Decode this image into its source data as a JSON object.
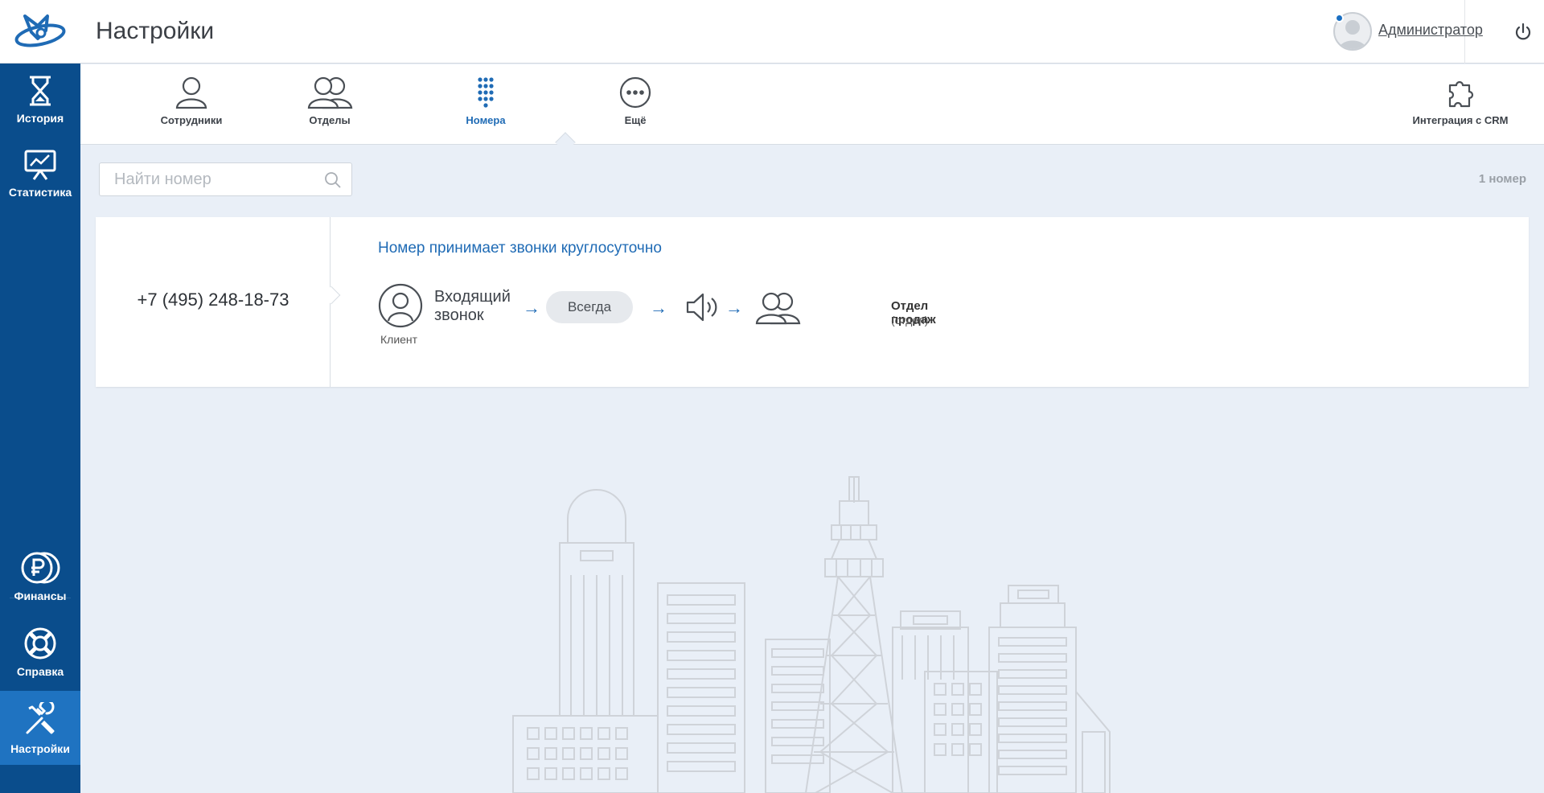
{
  "header": {
    "title": "Настройки",
    "user_name": "Администратор"
  },
  "sidebar": {
    "items": [
      {
        "label": "История",
        "icon": "hourglass-icon"
      },
      {
        "label": "Статистика",
        "icon": "presentation-chart-icon"
      },
      {
        "label": "Финансы",
        "icon": "ruble-coins-icon"
      },
      {
        "label": "Справка",
        "icon": "lifebuoy-icon"
      },
      {
        "label": "Настройки",
        "icon": "tools-icon"
      }
    ],
    "active": "Настройки"
  },
  "tabs": {
    "items": [
      {
        "label": "Сотрудники",
        "icon": "user-icon"
      },
      {
        "label": "Отделы",
        "icon": "users-icon"
      },
      {
        "label": "Номера",
        "icon": "keypad-icon"
      },
      {
        "label": "Ещё",
        "icon": "more-icon"
      }
    ],
    "active": "Номера",
    "crm": {
      "label": "Интеграция с CRM",
      "icon": "puzzle-icon"
    }
  },
  "search": {
    "placeholder": "Найти номер",
    "value": ""
  },
  "count": "1 номер",
  "numbers": [
    {
      "phone": "+7 (495) 248-18-73",
      "title": "Номер принимает звонки круглосуточно",
      "client_label": "Клиент",
      "incoming_line1": "Входящий",
      "incoming_line2": "звонок",
      "schedule": "Всегда",
      "destination_name": "Отдел продаж",
      "destination_type": "(отдел)"
    }
  ],
  "colors": {
    "sidebar": "#0a4d8c",
    "sidebar_active": "#1f73c1",
    "accent": "#1f6bb5",
    "background": "#e9eff7"
  }
}
